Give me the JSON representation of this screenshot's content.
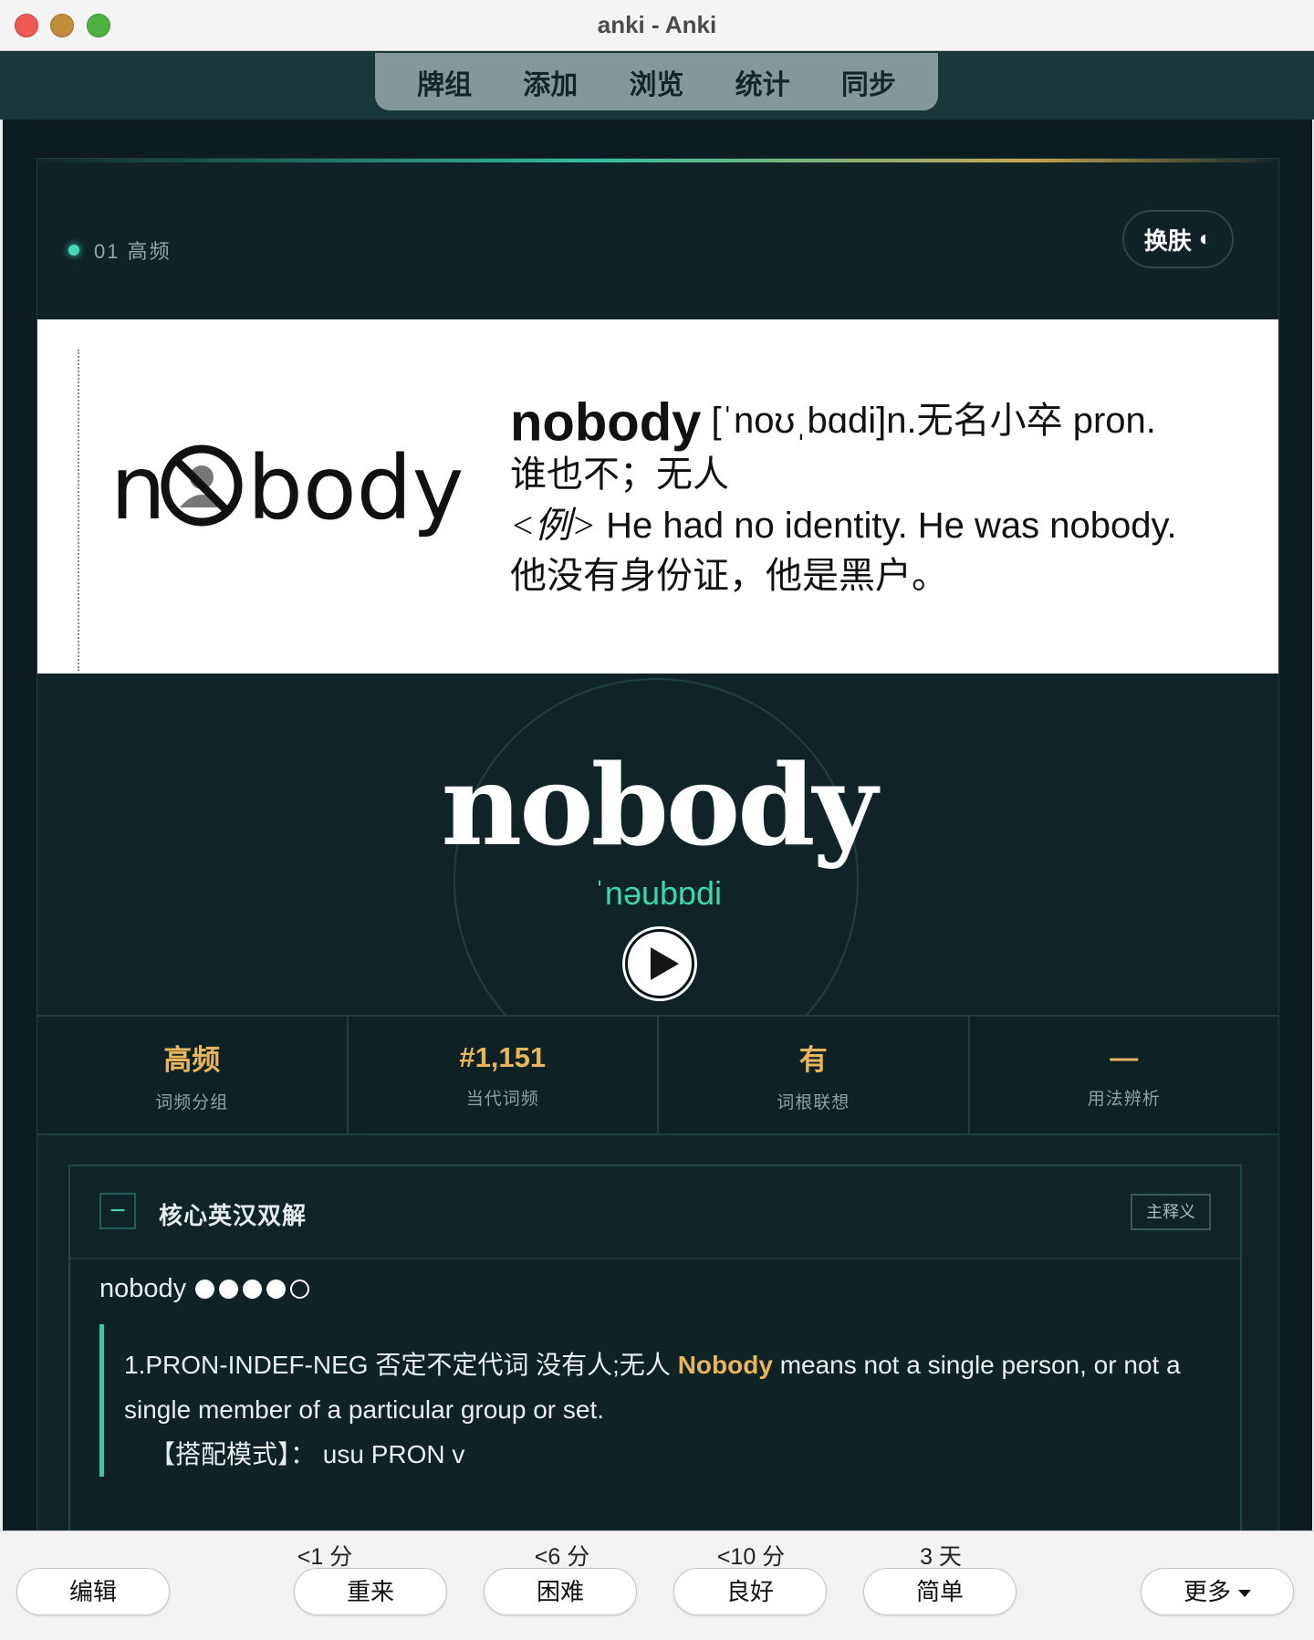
{
  "window": {
    "title": "anki - Anki"
  },
  "toolbar": {
    "items": [
      "牌组",
      "添加",
      "浏览",
      "统计",
      "同步"
    ]
  },
  "card": {
    "tag": "01 高频",
    "skin_label": "换肤",
    "skin_icon": "◐",
    "dictionary": {
      "logo_prefix": "n",
      "logo_suffix": "body",
      "word": "nobody",
      "ipa_pos": "[ˈnoʊˌbɑdi]n.无名小卒 pron.",
      "meaning": "谁也不；无人",
      "example_tag": "<例>",
      "example_en": " He had no identity. He was nobody.",
      "example_cn": "他没有身份证，他是黑户。"
    },
    "headword": "nobody",
    "phonetic": "ˈnəubɒdi",
    "stats": [
      {
        "value": "高频",
        "label": "词频分组"
      },
      {
        "value": "#1,151",
        "label": "当代词频"
      },
      {
        "value": "有",
        "label": "词根联想"
      },
      {
        "value": "—",
        "label": "用法辨析"
      }
    ],
    "panel": {
      "collapse_symbol": "−",
      "title": "核心英汉双解",
      "chip": "主释义",
      "entry_word": "nobody",
      "rating_filled": 4,
      "rating_total": 5,
      "sense_prefix": "1.PRON-INDEF-NEG 否定不定代词 没有人;无人 ",
      "sense_highlight": "Nobody",
      "sense_rest": " means not a single person, or not a single member of a particular group or set.",
      "pattern": "【搭配模式】： usu PRON v"
    }
  },
  "answer_bar": {
    "edit": "编辑",
    "more": "更多",
    "ratings": [
      {
        "timing": "<1 分",
        "label": "重来"
      },
      {
        "timing": "<6 分",
        "label": "困难"
      },
      {
        "timing": "<10 分",
        "label": "良好"
      },
      {
        "timing": "3 天",
        "label": "简单"
      }
    ]
  }
}
